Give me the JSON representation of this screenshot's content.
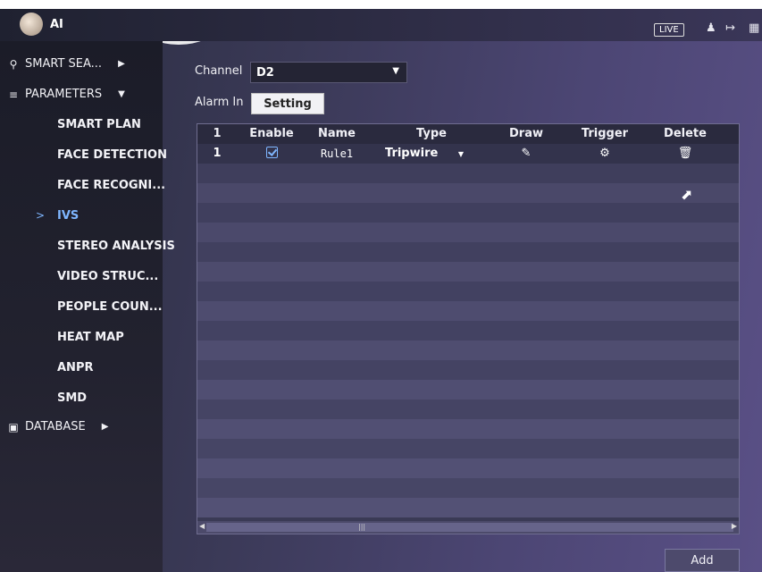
{
  "app": {
    "title": "AI"
  },
  "topbar": {
    "live_label": "LIVE",
    "icons": [
      "user-icon",
      "logout-icon",
      "layout-icon"
    ]
  },
  "sidebar": {
    "top_items": [
      {
        "label": "SMART SEA...",
        "icon": "search-icon"
      },
      {
        "label": "PARAMETERS",
        "icon": "list-icon"
      },
      {
        "label": "DATABASE",
        "icon": "database-icon"
      }
    ],
    "sub_items": [
      {
        "label": "SMART PLAN"
      },
      {
        "label": "FACE DETECTION"
      },
      {
        "label": "FACE RECOGNI..."
      },
      {
        "label": "IVS"
      },
      {
        "label": "STEREO ANALYSIS"
      },
      {
        "label": "VIDEO STRUC..."
      },
      {
        "label": "PEOPLE COUN..."
      },
      {
        "label": "HEAT MAP"
      },
      {
        "label": "ANPR"
      },
      {
        "label": "SMD"
      }
    ],
    "active_item": "IVS"
  },
  "form": {
    "channel_label": "Channel",
    "channel_value": "D2",
    "alarm_label": "Alarm In",
    "setting_button": "Setting"
  },
  "table": {
    "headers": [
      "1",
      "Enable",
      "Name",
      "Type",
      "Draw",
      "Trigger",
      "Delete"
    ],
    "rows": [
      {
        "index": "1",
        "enabled": true,
        "name": "Rule1",
        "type": "Tripwire"
      }
    ]
  },
  "actions": {
    "add_button": "Add"
  },
  "colors": {
    "accent": "#7fb6ff",
    "panel": "#3a3a55",
    "sidebar": "#1b1c28"
  }
}
